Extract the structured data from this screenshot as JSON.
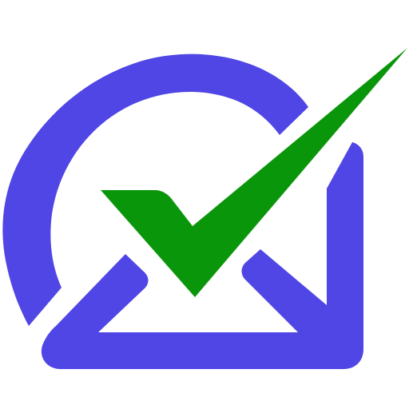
{
  "logo": {
    "icon": "checkmark-envelope-icon",
    "colors": {
      "accent": "#4f46e5",
      "check": "#0a960a",
      "background": "#ffffff"
    }
  }
}
